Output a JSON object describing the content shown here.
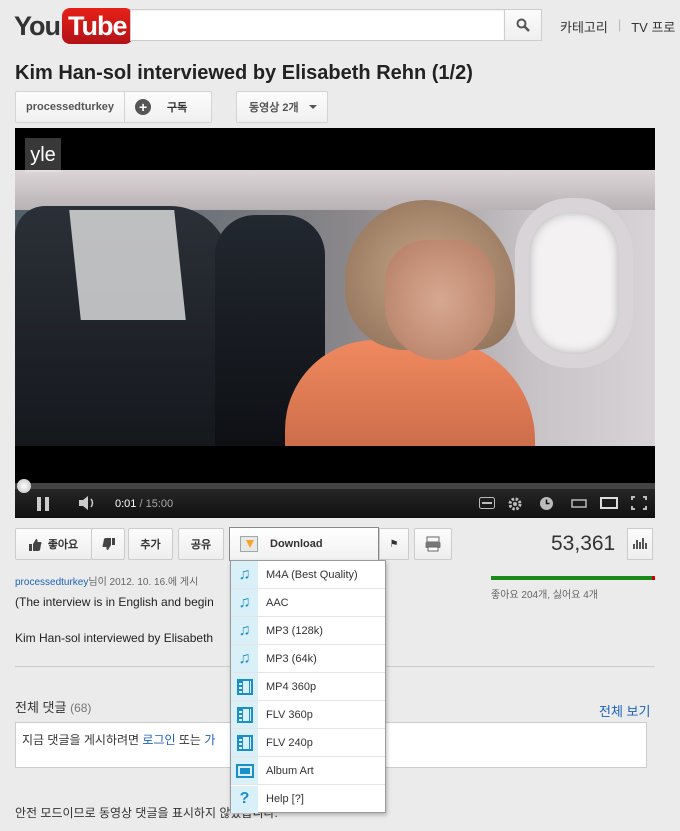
{
  "header": {
    "logo_you": "You",
    "logo_tube": "Tube",
    "search_value": "",
    "nav_categories": "카테고리",
    "nav_tv": "TV 프로"
  },
  "video": {
    "title": "Kim Han-sol interviewed by Elisabeth Rehn (1/2)",
    "channel": "processedturkey",
    "subscribe_label": "구독",
    "videos_label": "동영상 2개",
    "watermark": "yle",
    "current_time": "0:01",
    "duration": "/ 15:00",
    "progress_fraction": 0.001
  },
  "actions": {
    "like": "좋아요",
    "add": "추가",
    "share": "공유",
    "download": "Download",
    "views": "53,361"
  },
  "ratings": {
    "likes_text": "좋아요 204개, 싫어요 4개",
    "like_fraction": 0.981
  },
  "details": {
    "uploader": "processedturkey",
    "upload_suffix": "님이 2012. 10. 16.에 게시",
    "desc_line1": "(The interview is in English and begin",
    "desc_line2": "Kim Han-sol interviewed by Elisabeth"
  },
  "comments": {
    "heading": "전체 댓글",
    "count": "(68)",
    "view_all": "전체 보기",
    "prompt_prefix": "지금 댓글을 게시하려면",
    "login_link": "로그인",
    "prompt_or": "또는",
    "join_link": "가",
    "safe_mode": "안전 모드이므로 동영상 댓글을 표시하지 않았습니다."
  },
  "download_menu": {
    "items": [
      {
        "label": "M4A (Best Quality)",
        "icon": "music-note-icon"
      },
      {
        "label": "AAC",
        "icon": "music-note-icon"
      },
      {
        "label": "MP3 (128k)",
        "icon": "music-note-icon"
      },
      {
        "label": "MP3 (64k)",
        "icon": "music-note-icon"
      },
      {
        "label": "MP4 360p",
        "icon": "film-icon"
      },
      {
        "label": "FLV 360p",
        "icon": "film-icon"
      },
      {
        "label": "FLV 240p",
        "icon": "film-icon"
      },
      {
        "label": "Album Art",
        "icon": "image-icon"
      },
      {
        "label": "Help [?]",
        "icon": "question-icon"
      }
    ]
  },
  "colors": {
    "accent_link": "#1c62b9",
    "logo_red": "#e62117",
    "like_green": "#1a8a1a",
    "menu_icon_blue": "#1a8fc7"
  }
}
